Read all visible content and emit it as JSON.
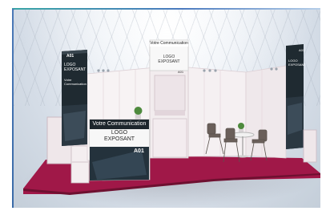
{
  "booth": {
    "left_tower": {
      "code": "A01",
      "logo_line1": "LOGO",
      "logo_line2": "EXPOSANT",
      "comm_line1": "Votre",
      "comm_line2": "Communication"
    },
    "top_sign": {
      "header": "Votre Communication",
      "logo_line1": "LOGO",
      "logo_line2": "EXPOSANT",
      "code": "A01"
    },
    "counter_banner": {
      "header": "Votre Communication",
      "logo_line1": "LOGO",
      "logo_line2": "EXPOSANT",
      "code": "A01"
    },
    "right_tower": {
      "code": "A01",
      "logo_line1": "LOGO",
      "logo_line2": "EXPOSANT"
    }
  },
  "colors": {
    "carpet": "#a01848",
    "wall": "#f6f3f3",
    "frame": "#d7c9cf",
    "dark_panel": "#1f2a31",
    "accent_top": "#3aa6a6",
    "accent_left": "#4b79b7"
  }
}
